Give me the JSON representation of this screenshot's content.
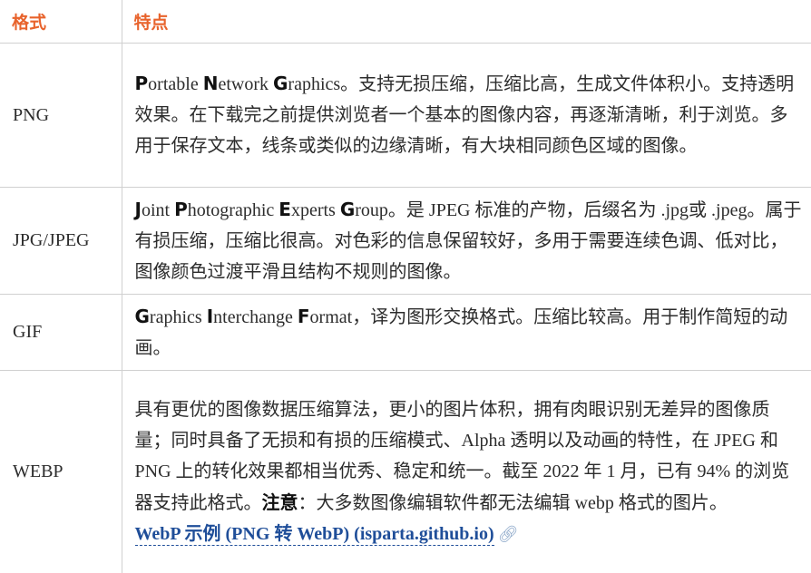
{
  "table": {
    "header": {
      "col1": "格式",
      "col2": "特点"
    },
    "rows": [
      {
        "name": "PNG",
        "desc": [
          {
            "t": "P",
            "cap": true
          },
          {
            "t": "ortable "
          },
          {
            "t": "N",
            "cap": true
          },
          {
            "t": "etwork "
          },
          {
            "t": "G",
            "cap": true
          },
          {
            "t": "raphics。支持无损压缩，压缩比高，生成文件体积小。支持透明效果。在下载完之前提供浏览者一个基本的图像内容，再逐渐清晰，利于浏览。多用于保存文本，线条或类似的边缘清晰，有大块相同颜色区域的图像。"
          }
        ]
      },
      {
        "name": "JPG/JPEG",
        "desc": [
          {
            "t": "J",
            "cap": true
          },
          {
            "t": "oint "
          },
          {
            "t": "P",
            "cap": true
          },
          {
            "t": "hotographic "
          },
          {
            "t": "E",
            "cap": true
          },
          {
            "t": "xperts "
          },
          {
            "t": "G",
            "cap": true
          },
          {
            "t": "roup。是 JPEG 标准的产物，后缀名为 .jpg或 .jpeg。属于有损压缩，压缩比很高。对色彩的信息保留较好，多用于需要连续色调、低对比，图像颜色过渡平滑且结构不规则的图像。"
          }
        ]
      },
      {
        "name": "GIF",
        "desc": [
          {
            "t": "G",
            "cap": true
          },
          {
            "t": "raphics "
          },
          {
            "t": "I",
            "cap": true
          },
          {
            "t": "nterchange "
          },
          {
            "t": "F",
            "cap": true
          },
          {
            "t": "ormat，译为图形交换格式。压缩比较高。用于制作简短的动画。"
          }
        ]
      },
      {
        "name": "WEBP",
        "desc": [
          {
            "t": "具有更优的图像数据压缩算法，更小的图片体积，拥有肉眼识别无差异的图像质量；同时具备了无损和有损的压缩模式、Alpha 透明以及动画的特性，在 JPEG 和 PNG 上的转化效果都相当优秀、稳定和统一。截至 2022 年 1 月，已有 94% 的浏览器支持此格式。"
          },
          {
            "t": "注意",
            "strong": true
          },
          {
            "t": "：大多数图像编辑软件都无法编辑 webp 格式的图片。"
          }
        ],
        "link": "WebP 示例 (PNG 转 WebP) (isparta.github.io)",
        "link_icon": "external-link-icon"
      }
    ]
  },
  "colors": {
    "header_text": "#e8632c",
    "link": "#1f4e99",
    "border": "#d0d0d0"
  }
}
